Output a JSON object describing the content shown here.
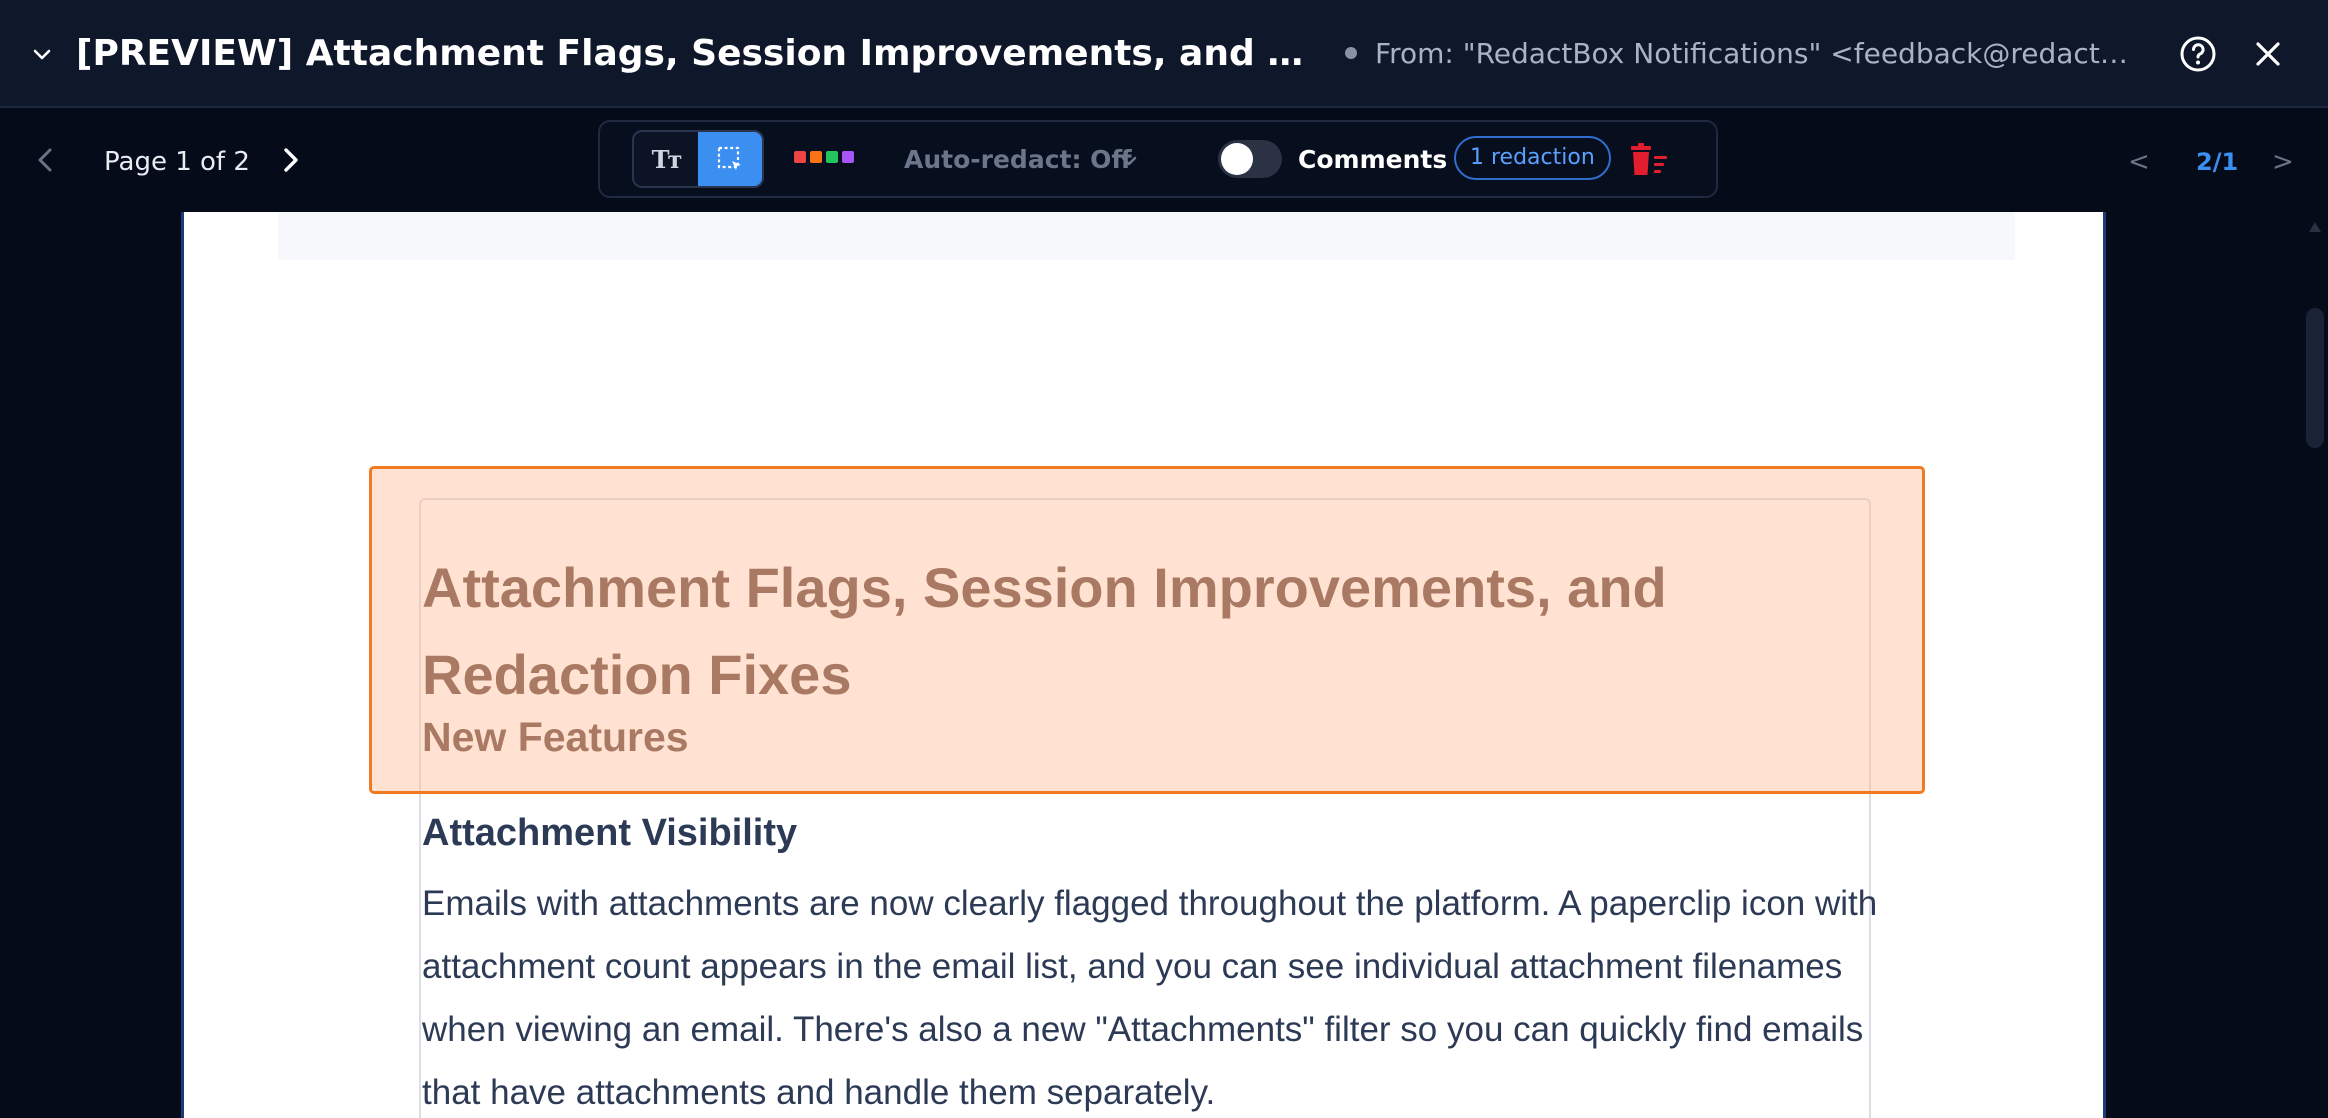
{
  "header": {
    "subject": "[PREVIEW] Attachment Flags, Session Improvements, and Redaction F...",
    "from": "From: \"RedactBox Notifications\" <feedback@redactbox...."
  },
  "toolbar": {
    "page_label": "Page 1 of 2",
    "text_mode_glyph": "Tт",
    "auto_redact_label": "Auto-redact: Off",
    "comments_label": "Comments",
    "comments_enabled": false,
    "redaction_badge": "1 redaction",
    "swatch_colors": [
      "#ef4444",
      "#f97316",
      "#22c55e",
      "#a855f7"
    ],
    "nav_prev": "<",
    "nav_count": "2/1",
    "nav_next": ">"
  },
  "document": {
    "title": "Attachment Flags, Session Improvements, and Redaction Fixes",
    "section_heading": "New Features",
    "subsection_heading": "Attachment Visibility",
    "paragraph": "Emails with attachments are now clearly flagged throughout the platform. A paperclip icon with attachment count appears in the email list, and you can see individual attachment filenames when viewing an email. There's also a new \"Attachments\" filter so you can quickly find emails that have attachments and handle them separately."
  },
  "colors": {
    "accent": "#3b8ff0",
    "redaction_border": "#f07a22",
    "redaction_fill": "#ffbb91",
    "delete_red": "#e11d2e"
  },
  "icons": {
    "collapse": "chevron-down-icon",
    "help": "help-circle-icon",
    "close": "close-icon",
    "prev_page": "chevron-left-icon",
    "next_page": "chevron-right-icon",
    "area_select": "area-select-icon",
    "delete_redactions": "trash-list-icon"
  }
}
